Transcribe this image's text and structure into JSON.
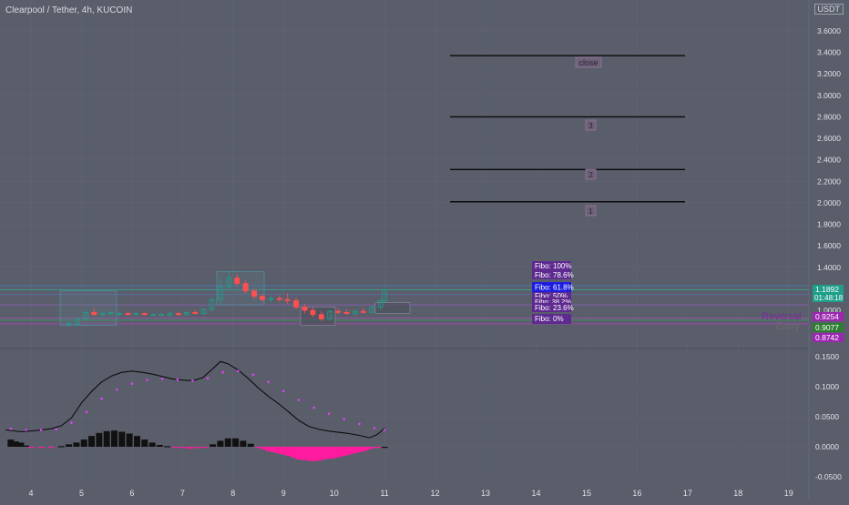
{
  "header": {
    "title": "Clearpool / Tether, 4h, KUCOIN",
    "unit_badge": "USDT"
  },
  "colors": {
    "background": "#5a5e6b",
    "bull": "#1f9e8a",
    "bear": "#ff4f4f",
    "signal": "#e040fb",
    "macd_pos": "#111111",
    "macd_neg": "#ff1a9e",
    "macd_line": "#0d0d0d"
  },
  "price_axis": {
    "ticks": [
      "3.6000",
      "3.4000",
      "3.2000",
      "3.0000",
      "2.8000",
      "2.6000",
      "2.4000",
      "2.2000",
      "2.0000",
      "1.8000",
      "1.6000",
      "1.4000",
      "1.2000",
      "1.0000"
    ],
    "top_tick": "3"
  },
  "osc_axis": {
    "ticks": [
      "0.1500",
      "0.1000",
      "0.0500",
      "0.0000",
      "-0.0500"
    ]
  },
  "x_axis": {
    "ticks": [
      "4",
      "5",
      "6",
      "7",
      "8",
      "9",
      "10",
      "11",
      "12",
      "13",
      "14",
      "15",
      "16",
      "17",
      "18",
      "19"
    ]
  },
  "price_labels": {
    "last": "1.1892",
    "countdown": "01:48:18",
    "level_a": "0.9254",
    "level_b": "0.9077",
    "level_c": "0.8742",
    "note_a": "Reversal",
    "note_b": "Entry"
  },
  "targets": {
    "close_label": "close",
    "t3": "3",
    "t2": "2",
    "t1": "1"
  },
  "fibo": {
    "f100": "Fibo: 100%",
    "f78": "Fibo: 78.6%",
    "f61": "Fibo: 61.8%",
    "f50": "Fibo: 50%",
    "f38": "Fibo: 38.2%",
    "f23": "Fibo: 23.6%",
    "f0": "Fibo: 0%"
  },
  "chart_data": {
    "type": "candlestick",
    "x_unit": "day of month",
    "price_ylim": [
      0.85,
      3.8
    ],
    "osc_ylim": [
      -0.06,
      0.18
    ],
    "target_levels": [
      {
        "label": "close",
        "value": 3.37
      },
      {
        "label": "3",
        "value": 2.8
      },
      {
        "label": "2",
        "value": 2.31
      },
      {
        "label": "1",
        "value": 2.01
      }
    ],
    "horizontal_levels": [
      1.2285,
      1.1892,
      1.15,
      1.05,
      0.9254,
      0.9077,
      0.8742
    ],
    "candles": [
      {
        "x": 4.75,
        "o": 0.87,
        "h": 0.9,
        "l": 0.85,
        "c": 0.88
      },
      {
        "x": 4.92,
        "o": 0.87,
        "h": 0.93,
        "l": 0.86,
        "c": 0.92
      },
      {
        "x": 5.08,
        "o": 0.92,
        "h": 1.0,
        "l": 0.9,
        "c": 0.98
      },
      {
        "x": 5.25,
        "o": 0.98,
        "h": 1.02,
        "l": 0.95,
        "c": 0.96
      },
      {
        "x": 5.42,
        "o": 0.96,
        "h": 0.99,
        "l": 0.94,
        "c": 0.97
      },
      {
        "x": 5.58,
        "o": 0.97,
        "h": 0.99,
        "l": 0.95,
        "c": 0.98
      },
      {
        "x": 5.75,
        "o": 0.96,
        "h": 0.98,
        "l": 0.94,
        "c": 0.97
      },
      {
        "x": 5.92,
        "o": 0.97,
        "h": 0.99,
        "l": 0.95,
        "c": 0.96
      },
      {
        "x": 6.08,
        "o": 0.96,
        "h": 0.98,
        "l": 0.95,
        "c": 0.97
      },
      {
        "x": 6.25,
        "o": 0.97,
        "h": 0.98,
        "l": 0.95,
        "c": 0.96
      },
      {
        "x": 6.42,
        "o": 0.96,
        "h": 0.97,
        "l": 0.95,
        "c": 0.96
      },
      {
        "x": 6.58,
        "o": 0.96,
        "h": 0.97,
        "l": 0.95,
        "c": 0.96
      },
      {
        "x": 6.75,
        "o": 0.95,
        "h": 0.99,
        "l": 0.95,
        "c": 0.97
      },
      {
        "x": 6.92,
        "o": 0.97,
        "h": 0.98,
        "l": 0.95,
        "c": 0.96
      },
      {
        "x": 7.08,
        "o": 0.96,
        "h": 0.99,
        "l": 0.96,
        "c": 0.98
      },
      {
        "x": 7.25,
        "o": 0.98,
        "h": 1.0,
        "l": 0.96,
        "c": 0.97
      },
      {
        "x": 7.42,
        "o": 0.97,
        "h": 1.02,
        "l": 0.96,
        "c": 1.01
      },
      {
        "x": 7.58,
        "o": 1.01,
        "h": 1.12,
        "l": 0.99,
        "c": 1.1
      },
      {
        "x": 7.75,
        "o": 1.1,
        "h": 1.3,
        "l": 1.05,
        "c": 1.22
      },
      {
        "x": 7.92,
        "o": 1.22,
        "h": 1.36,
        "l": 1.18,
        "c": 1.3
      },
      {
        "x": 8.08,
        "o": 1.3,
        "h": 1.34,
        "l": 1.22,
        "c": 1.25
      },
      {
        "x": 8.25,
        "o": 1.25,
        "h": 1.28,
        "l": 1.16,
        "c": 1.18
      },
      {
        "x": 8.42,
        "o": 1.18,
        "h": 1.2,
        "l": 1.1,
        "c": 1.13
      },
      {
        "x": 8.58,
        "o": 1.13,
        "h": 1.15,
        "l": 1.08,
        "c": 1.1
      },
      {
        "x": 8.75,
        "o": 1.1,
        "h": 1.13,
        "l": 1.07,
        "c": 1.11
      },
      {
        "x": 8.92,
        "o": 1.11,
        "h": 1.14,
        "l": 1.08,
        "c": 1.1
      },
      {
        "x": 9.08,
        "o": 1.1,
        "h": 1.16,
        "l": 1.06,
        "c": 1.09
      },
      {
        "x": 9.25,
        "o": 1.09,
        "h": 1.12,
        "l": 1.01,
        "c": 1.03
      },
      {
        "x": 9.42,
        "o": 1.03,
        "h": 1.06,
        "l": 0.97,
        "c": 1.0
      },
      {
        "x": 9.58,
        "o": 1.0,
        "h": 1.03,
        "l": 0.94,
        "c": 0.96
      },
      {
        "x": 9.75,
        "o": 0.96,
        "h": 0.99,
        "l": 0.9,
        "c": 0.92
      },
      {
        "x": 9.92,
        "o": 0.92,
        "h": 1.0,
        "l": 0.91,
        "c": 0.99
      },
      {
        "x": 10.08,
        "o": 0.99,
        "h": 1.02,
        "l": 0.96,
        "c": 0.98
      },
      {
        "x": 10.25,
        "o": 0.98,
        "h": 1.01,
        "l": 0.96,
        "c": 0.97
      },
      {
        "x": 10.42,
        "o": 0.97,
        "h": 1.0,
        "l": 0.95,
        "c": 0.99
      },
      {
        "x": 10.58,
        "o": 0.99,
        "h": 1.02,
        "l": 0.97,
        "c": 0.98
      },
      {
        "x": 10.75,
        "o": 0.98,
        "h": 1.04,
        "l": 0.97,
        "c": 1.03
      },
      {
        "x": 10.92,
        "o": 1.03,
        "h": 1.1,
        "l": 1.0,
        "c": 1.09
      },
      {
        "x": 11.0,
        "o": 1.09,
        "h": 1.21,
        "l": 1.07,
        "c": 1.19
      }
    ],
    "macd_histogram": [
      {
        "x": 3.6,
        "v": 0.012
      },
      {
        "x": 3.7,
        "v": 0.009
      },
      {
        "x": 3.8,
        "v": 0.007
      },
      {
        "x": 3.9,
        "v": 0.002
      },
      {
        "x": 4.0,
        "v": -0.001
      },
      {
        "x": 4.2,
        "v": -0.001
      },
      {
        "x": 4.4,
        "v": -0.001
      },
      {
        "x": 4.6,
        "v": 0.001
      },
      {
        "x": 4.75,
        "v": 0.004
      },
      {
        "x": 4.9,
        "v": 0.007
      },
      {
        "x": 5.05,
        "v": 0.012
      },
      {
        "x": 5.2,
        "v": 0.018
      },
      {
        "x": 5.35,
        "v": 0.023
      },
      {
        "x": 5.5,
        "v": 0.026
      },
      {
        "x": 5.65,
        "v": 0.027
      },
      {
        "x": 5.8,
        "v": 0.025
      },
      {
        "x": 5.95,
        "v": 0.022
      },
      {
        "x": 6.1,
        "v": 0.018
      },
      {
        "x": 6.25,
        "v": 0.012
      },
      {
        "x": 6.4,
        "v": 0.007
      },
      {
        "x": 6.55,
        "v": 0.003
      },
      {
        "x": 6.7,
        "v": 0.001
      },
      {
        "x": 6.85,
        "v": -0.001
      },
      {
        "x": 7.0,
        "v": -0.002
      },
      {
        "x": 7.15,
        "v": -0.003
      },
      {
        "x": 7.3,
        "v": -0.002
      },
      {
        "x": 7.45,
        "v": -0.001
      },
      {
        "x": 7.6,
        "v": 0.004
      },
      {
        "x": 7.75,
        "v": 0.01
      },
      {
        "x": 7.9,
        "v": 0.014
      },
      {
        "x": 8.05,
        "v": 0.014
      },
      {
        "x": 8.2,
        "v": 0.01
      },
      {
        "x": 8.35,
        "v": 0.005
      },
      {
        "x": 8.5,
        "v": -0.001
      },
      {
        "x": 8.6,
        "v": -0.004
      },
      {
        "x": 8.7,
        "v": -0.007
      },
      {
        "x": 8.8,
        "v": -0.009
      },
      {
        "x": 8.9,
        "v": -0.011
      },
      {
        "x": 9.0,
        "v": -0.013
      },
      {
        "x": 9.1,
        "v": -0.015
      },
      {
        "x": 9.2,
        "v": -0.018
      },
      {
        "x": 9.3,
        "v": -0.021
      },
      {
        "x": 9.4,
        "v": -0.022
      },
      {
        "x": 9.5,
        "v": -0.023
      },
      {
        "x": 9.6,
        "v": -0.024
      },
      {
        "x": 9.7,
        "v": -0.023
      },
      {
        "x": 9.8,
        "v": -0.021
      },
      {
        "x": 9.9,
        "v": -0.02
      },
      {
        "x": 10.0,
        "v": -0.019
      },
      {
        "x": 10.1,
        "v": -0.017
      },
      {
        "x": 10.2,
        "v": -0.015
      },
      {
        "x": 10.3,
        "v": -0.013
      },
      {
        "x": 10.4,
        "v": -0.011
      },
      {
        "x": 10.5,
        "v": -0.009
      },
      {
        "x": 10.6,
        "v": -0.007
      },
      {
        "x": 10.7,
        "v": -0.004
      },
      {
        "x": 10.8,
        "v": -0.001
      },
      {
        "x": 10.9,
        "v": -0.001
      },
      {
        "x": 11.0,
        "v": 0.0
      }
    ],
    "macd_line": [
      {
        "x": 3.5,
        "v": 0.028
      },
      {
        "x": 3.8,
        "v": 0.025
      },
      {
        "x": 4.1,
        "v": 0.027
      },
      {
        "x": 4.4,
        "v": 0.03
      },
      {
        "x": 4.6,
        "v": 0.035
      },
      {
        "x": 4.8,
        "v": 0.048
      },
      {
        "x": 5.0,
        "v": 0.073
      },
      {
        "x": 5.2,
        "v": 0.092
      },
      {
        "x": 5.4,
        "v": 0.108
      },
      {
        "x": 5.6,
        "v": 0.118
      },
      {
        "x": 5.8,
        "v": 0.124
      },
      {
        "x": 6.0,
        "v": 0.126
      },
      {
        "x": 6.2,
        "v": 0.124
      },
      {
        "x": 6.4,
        "v": 0.121
      },
      {
        "x": 6.6,
        "v": 0.117
      },
      {
        "x": 6.8,
        "v": 0.113
      },
      {
        "x": 7.0,
        "v": 0.111
      },
      {
        "x": 7.2,
        "v": 0.11
      },
      {
        "x": 7.4,
        "v": 0.115
      },
      {
        "x": 7.6,
        "v": 0.13
      },
      {
        "x": 7.75,
        "v": 0.142
      },
      {
        "x": 7.9,
        "v": 0.138
      },
      {
        "x": 8.1,
        "v": 0.128
      },
      {
        "x": 8.3,
        "v": 0.114
      },
      {
        "x": 8.5,
        "v": 0.098
      },
      {
        "x": 8.7,
        "v": 0.084
      },
      {
        "x": 8.9,
        "v": 0.072
      },
      {
        "x": 9.1,
        "v": 0.058
      },
      {
        "x": 9.3,
        "v": 0.044
      },
      {
        "x": 9.5,
        "v": 0.034
      },
      {
        "x": 9.7,
        "v": 0.029
      },
      {
        "x": 9.9,
        "v": 0.026
      },
      {
        "x": 10.1,
        "v": 0.024
      },
      {
        "x": 10.3,
        "v": 0.022
      },
      {
        "x": 10.5,
        "v": 0.019
      },
      {
        "x": 10.7,
        "v": 0.015
      },
      {
        "x": 10.85,
        "v": 0.02
      },
      {
        "x": 11.0,
        "v": 0.031
      }
    ],
    "signal_line": [
      {
        "x": 3.6,
        "v": 0.03
      },
      {
        "x": 3.9,
        "v": 0.028
      },
      {
        "x": 4.2,
        "v": 0.028
      },
      {
        "x": 4.5,
        "v": 0.029
      },
      {
        "x": 4.8,
        "v": 0.04
      },
      {
        "x": 5.1,
        "v": 0.058
      },
      {
        "x": 5.4,
        "v": 0.08
      },
      {
        "x": 5.7,
        "v": 0.095
      },
      {
        "x": 6.0,
        "v": 0.105
      },
      {
        "x": 6.3,
        "v": 0.111
      },
      {
        "x": 6.6,
        "v": 0.113
      },
      {
        "x": 6.9,
        "v": 0.112
      },
      {
        "x": 7.2,
        "v": 0.11
      },
      {
        "x": 7.5,
        "v": 0.114
      },
      {
        "x": 7.8,
        "v": 0.124
      },
      {
        "x": 8.1,
        "v": 0.126
      },
      {
        "x": 8.4,
        "v": 0.12
      },
      {
        "x": 8.7,
        "v": 0.108
      },
      {
        "x": 9.0,
        "v": 0.093
      },
      {
        "x": 9.3,
        "v": 0.078
      },
      {
        "x": 9.6,
        "v": 0.065
      },
      {
        "x": 9.9,
        "v": 0.055
      },
      {
        "x": 10.2,
        "v": 0.046
      },
      {
        "x": 10.5,
        "v": 0.038
      },
      {
        "x": 10.8,
        "v": 0.031
      },
      {
        "x": 11.0,
        "v": 0.028
      }
    ]
  }
}
